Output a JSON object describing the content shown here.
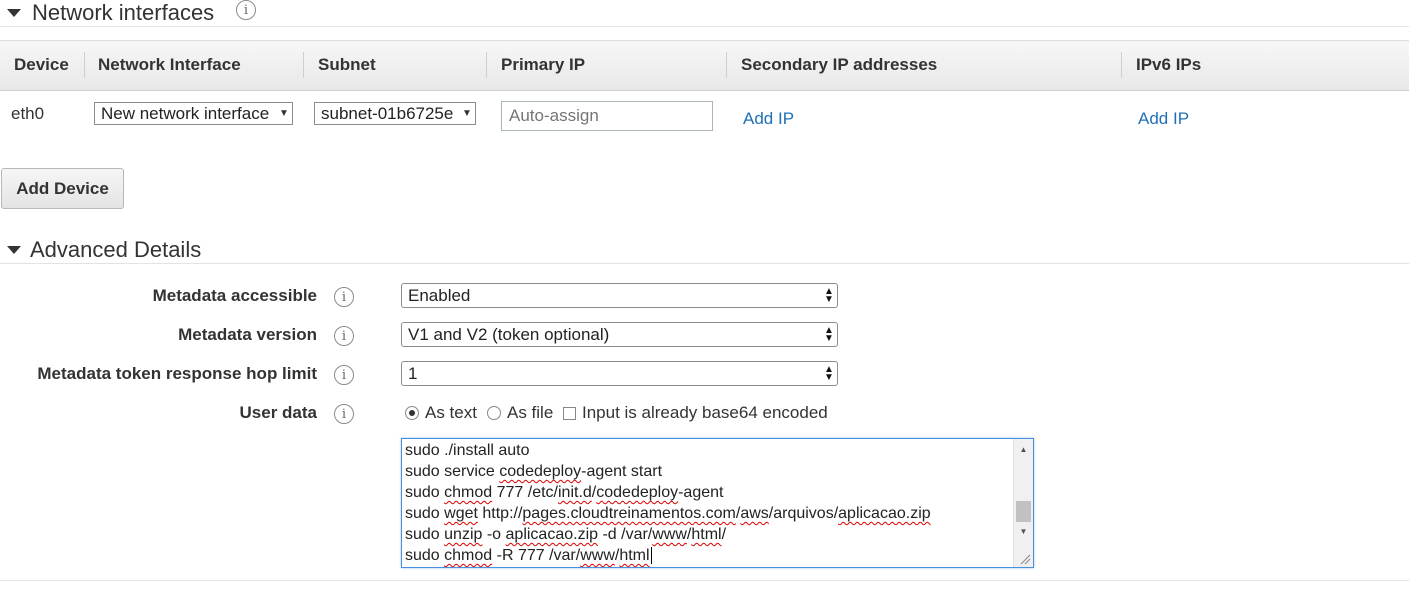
{
  "network": {
    "title": "Network interfaces",
    "columns": [
      "Device",
      "Network Interface",
      "Subnet",
      "Primary IP",
      "Secondary IP addresses",
      "IPv6 IPs"
    ],
    "row": {
      "device": "eth0",
      "network_interface": "New network interface",
      "subnet": "subnet-01b6725e",
      "primary_ip_placeholder": "Auto-assign",
      "secondary_add": "Add IP",
      "ipv6_add": "Add IP"
    },
    "add_device": "Add Device"
  },
  "advanced": {
    "title": "Advanced Details",
    "fields": [
      {
        "label": "Metadata accessible",
        "value": "Enabled"
      },
      {
        "label": "Metadata version",
        "value": "V1 and V2 (token optional)"
      },
      {
        "label": "Metadata token response hop limit",
        "value": "1"
      }
    ],
    "user_data": {
      "label": "User data",
      "options": {
        "as_text": "As text",
        "as_file": "As file",
        "base64": "Input is already base64 encoded"
      },
      "selected": "as_text",
      "base64_checked": false,
      "lines": [
        "sudo ./install auto",
        "sudo service codedeploy-agent start",
        "sudo chmod 777 /etc/init.d/codedeploy-agent",
        "sudo wget http://pages.cloudtreinamentos.com/aws/arquivos/aplicacao.zip",
        "sudo unzip -o aplicacao.zip -d /var/www/html/",
        "sudo chmod -R 777 /var/www/html"
      ]
    }
  },
  "icons": {
    "info": "info-icon",
    "collapse": "caret-down-icon",
    "dropdown": "dropdown-caret-icon",
    "select_arrows": "up-down-arrows-icon",
    "resize": "resize-handle-icon"
  }
}
